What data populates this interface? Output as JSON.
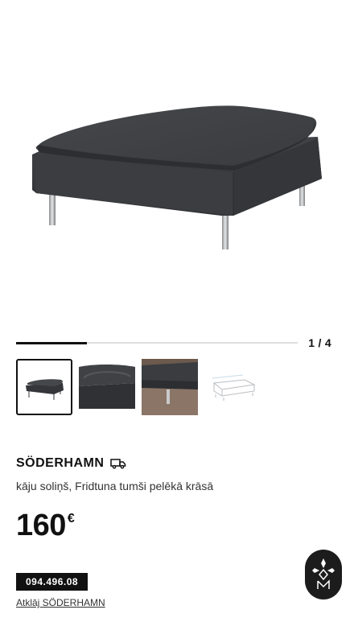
{
  "gallery": {
    "counter": "1 / 4",
    "current": 1,
    "total": 4,
    "progress": 0.25,
    "thumbnails": [
      {
        "name": "footstool-front"
      },
      {
        "name": "cushion-detail"
      },
      {
        "name": "leg-detail"
      },
      {
        "name": "dimensions-drawing"
      }
    ]
  },
  "product": {
    "name": "SÖDERHAMN",
    "delivery_icon": "truck-icon",
    "description": "kāju soliņš, Fridtuna tumši pelēkā krāsā",
    "price": "160",
    "currency": "€",
    "article_number": "094.496.08",
    "open_link": "Atklāj SÖDERHAMN"
  },
  "assistant": {
    "icon": "diamond-logo-icon"
  },
  "colors": {
    "fabric": "#3a3c3f",
    "text": "#111111",
    "accent_dark": "#1c1c1c"
  }
}
